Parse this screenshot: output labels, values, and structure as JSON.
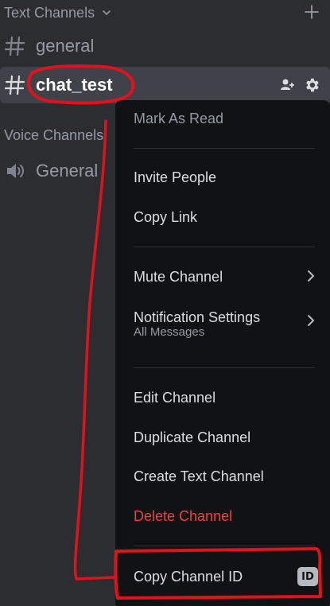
{
  "sidebar": {
    "text_category": "Text Channels",
    "voice_category": "Voice Channels",
    "channels": [
      {
        "name": "general"
      },
      {
        "name": "chat_test"
      }
    ],
    "voice_channels": [
      {
        "name": "General"
      }
    ]
  },
  "context_menu": {
    "mark_as_read": "Mark As Read",
    "invite_people": "Invite People",
    "copy_link": "Copy Link",
    "mute_channel": "Mute Channel",
    "notification_settings": "Notification Settings",
    "notification_settings_sub": "All Messages",
    "edit_channel": "Edit Channel",
    "duplicate_channel": "Duplicate Channel",
    "create_text_channel": "Create Text Channel",
    "delete_channel": "Delete Channel",
    "copy_channel_id": "Copy Channel ID",
    "id_badge": "ID"
  },
  "colors": {
    "background": "#2b2d31",
    "menu_background": "#111214",
    "danger": "#f23f42",
    "annotation": "#e0121c"
  },
  "icons": [
    "chevron-down-icon",
    "plus-icon",
    "hash-icon",
    "add-member-icon",
    "gear-icon",
    "speaker-icon",
    "chevron-right-icon",
    "id-icon"
  ]
}
